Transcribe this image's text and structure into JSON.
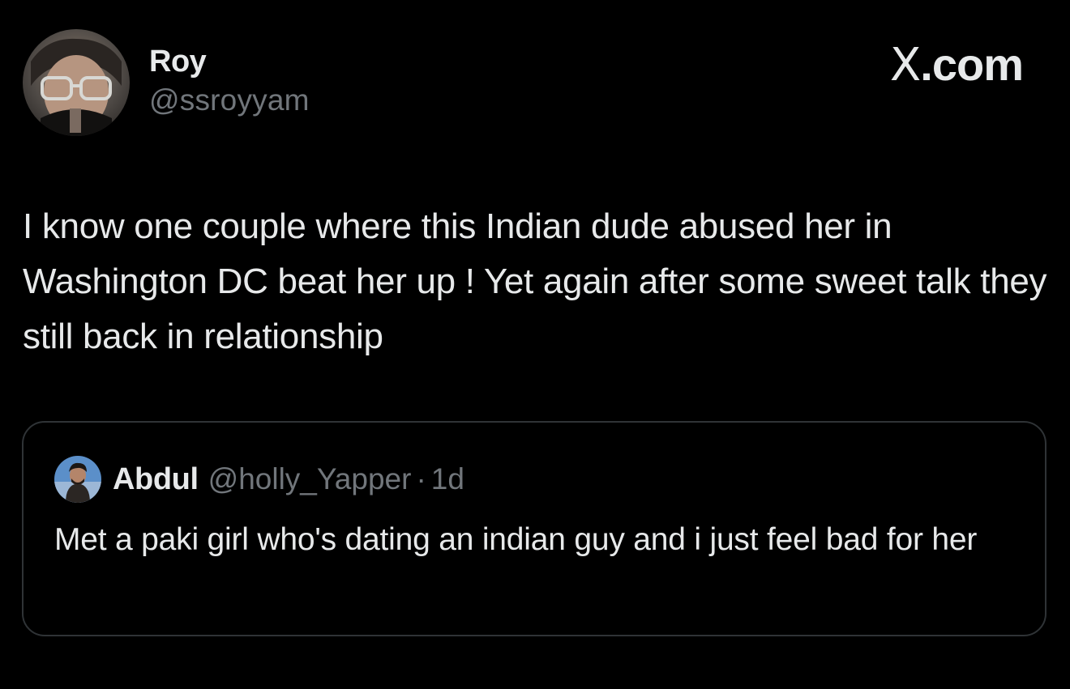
{
  "post": {
    "author": {
      "display_name": "Roy",
      "handle": "@ssroyyam"
    },
    "brand": {
      "glyph": "X",
      "suffix": ".com"
    },
    "text": "I know one couple where this Indian dude abused her in Washington DC beat her up ! Yet again after some sweet talk they still back in relationship",
    "quoted_post": {
      "author": {
        "display_name": "Abdul",
        "handle": "@holly_Yapper"
      },
      "separator": "·",
      "timestamp": "1d",
      "text": "Met a paki girl who's dating an indian guy and i just feel bad for her"
    }
  },
  "colors": {
    "background": "#000000",
    "primary_text": "#e7e9ea",
    "secondary_text": "#71767b",
    "border": "#2f3336"
  },
  "icons": {
    "author_avatar": "profile-photo",
    "quoted_author_avatar": "profile-photo"
  }
}
